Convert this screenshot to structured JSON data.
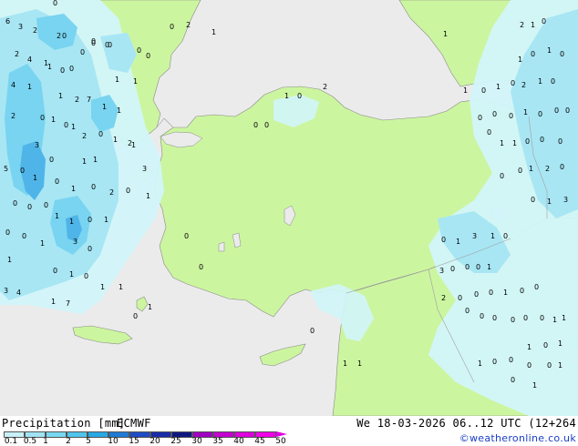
{
  "footer": {
    "title": "Precipitation [mm]",
    "model": "ECMWF",
    "validity": "We 18-03-2026 06..12 UTC (12+264",
    "copyright": "©weatheronline.co.uk"
  },
  "legend": {
    "labels": [
      "0.1",
      "0.5",
      "1",
      "2",
      "5",
      "10",
      "15",
      "20",
      "25",
      "30",
      "35",
      "40",
      "45",
      "50"
    ],
    "colors": [
      "#c8f0f8",
      "#a0e4f4",
      "#78d8f0",
      "#50c4ec",
      "#28a8e4",
      "#1f7ad4",
      "#1f4cc4",
      "#1a2ca8",
      "#101880",
      "#a000c0",
      "#c400d0",
      "#dc00dc",
      "#f000e8"
    ]
  },
  "map": {
    "colors": {
      "sea": "#ebebeb",
      "land": "#ccf5a0",
      "precip_light": "#d2f6fa",
      "precip_moderate": "#a8e6f4",
      "precip_heavy": "#78d4f0",
      "precip_core": "#4fb4e8",
      "border": "#a0a0a0"
    },
    "values": [
      "3",
      "2",
      "0",
      "6",
      "2",
      "4",
      "1",
      "2",
      "0",
      "4",
      "1",
      "1",
      "0",
      "0",
      "0",
      "0",
      "0",
      "1",
      "1",
      "2",
      "0",
      "1",
      "2",
      "7",
      "1",
      "1",
      "3",
      "1",
      "0",
      "1",
      "2",
      "0",
      "1",
      "2",
      "1",
      "3",
      "0",
      "1",
      "1",
      "5",
      "0",
      "1",
      "0",
      "1",
      "0",
      "2",
      "0",
      "1",
      "0",
      "0",
      "0",
      "1",
      "1",
      "0",
      "1",
      "0",
      "0",
      "1",
      "3",
      "0",
      "1",
      "0",
      "1",
      "0",
      "3",
      "4",
      "1",
      "7",
      "1",
      "1",
      "0",
      "1",
      "0",
      "2",
      "1",
      "0",
      "0",
      "0",
      "0",
      "0",
      "0",
      "0",
      "0",
      "1",
      "0",
      "2",
      "0",
      "1",
      "1",
      "1",
      "1",
      "0",
      "1",
      "0",
      "2",
      "1",
      "0",
      "1",
      "0",
      "1",
      "0",
      "2",
      "1",
      "0",
      "0",
      "0",
      "0",
      "1",
      "0",
      "0",
      "0",
      "0",
      "1",
      "1",
      "0",
      "0",
      "0",
      "0",
      "0",
      "1",
      "2",
      "0",
      "0",
      "1",
      "3",
      "0",
      "1",
      "3",
      "1",
      "0",
      "3",
      "0",
      "0",
      "0",
      "1",
      "2",
      "0",
      "0",
      "0",
      "1",
      "0",
      "0",
      "0",
      "0",
      "0",
      "0",
      "0",
      "0",
      "1",
      "1",
      "1",
      "0",
      "1",
      "1",
      "0",
      "0",
      "0",
      "0",
      "1",
      "0",
      "1",
      "1",
      "0",
      "0",
      "1",
      "1",
      "0",
      "0",
      "0",
      "1",
      "0",
      "0"
    ]
  }
}
